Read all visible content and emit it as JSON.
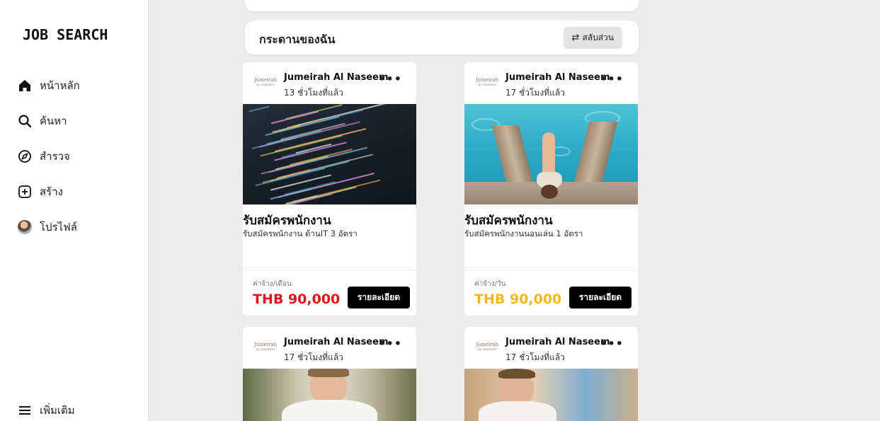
{
  "app": {
    "logo": "JOB SEARCH"
  },
  "sidebar": {
    "items": [
      {
        "label": "หน้าหลัก",
        "icon": "home-icon"
      },
      {
        "label": "ค้นหา",
        "icon": "search-icon"
      },
      {
        "label": "สำรวจ",
        "icon": "compass-icon"
      },
      {
        "label": "สร้าง",
        "icon": "plus-square-icon"
      },
      {
        "label": "โปรไฟล์",
        "icon": "avatar"
      }
    ],
    "more_label": "เพิ่มเติม"
  },
  "board": {
    "title": "กระดานของฉัน",
    "switch_label": "สลับส่วน",
    "switch_icon": "⇄"
  },
  "cards": [
    {
      "brand": "Jumeirah",
      "brand_sub": "AL NASEEM",
      "company": "Jumeirah Al Naseem",
      "time": "13 ชั่วโมงที่แล้ว",
      "title": "รับสมัครพนักงาน",
      "desc": "รับสมัครพนักงาน ด้านIT 3 อัตรา",
      "wage_label": "ค่าจ้าง/เดือน",
      "wage": "THB 90,000",
      "wage_color": "#e0161b",
      "button": "รายละเอียด",
      "more": "•••"
    },
    {
      "brand": "Jumeirah",
      "brand_sub": "AL NASEEM",
      "company": "Jumeirah Al Naseem",
      "time": "17 ชั่วโมงที่แล้ว",
      "title": "รับสมัครพนักงาน",
      "desc": "รับสมัครพนักงานนอนเล่น 1 อัตรา",
      "wage_label": "ค่าจ้าง/วัน",
      "wage": "THB 90,000",
      "wage_color": "#f4b918",
      "button": "รายละเอียด",
      "more": "•••"
    },
    {
      "brand": "Jumeirah",
      "brand_sub": "AL NASEEM",
      "company": "Jumeirah Al Naseem",
      "time": "17 ชั่วโมงที่แล้ว",
      "more": "•••"
    },
    {
      "brand": "Jumeirah",
      "brand_sub": "AL NASEEM",
      "company": "Jumeirah Al Naseem",
      "time": "17 ชั่วโมงที่แล้ว",
      "more": "•••"
    }
  ]
}
